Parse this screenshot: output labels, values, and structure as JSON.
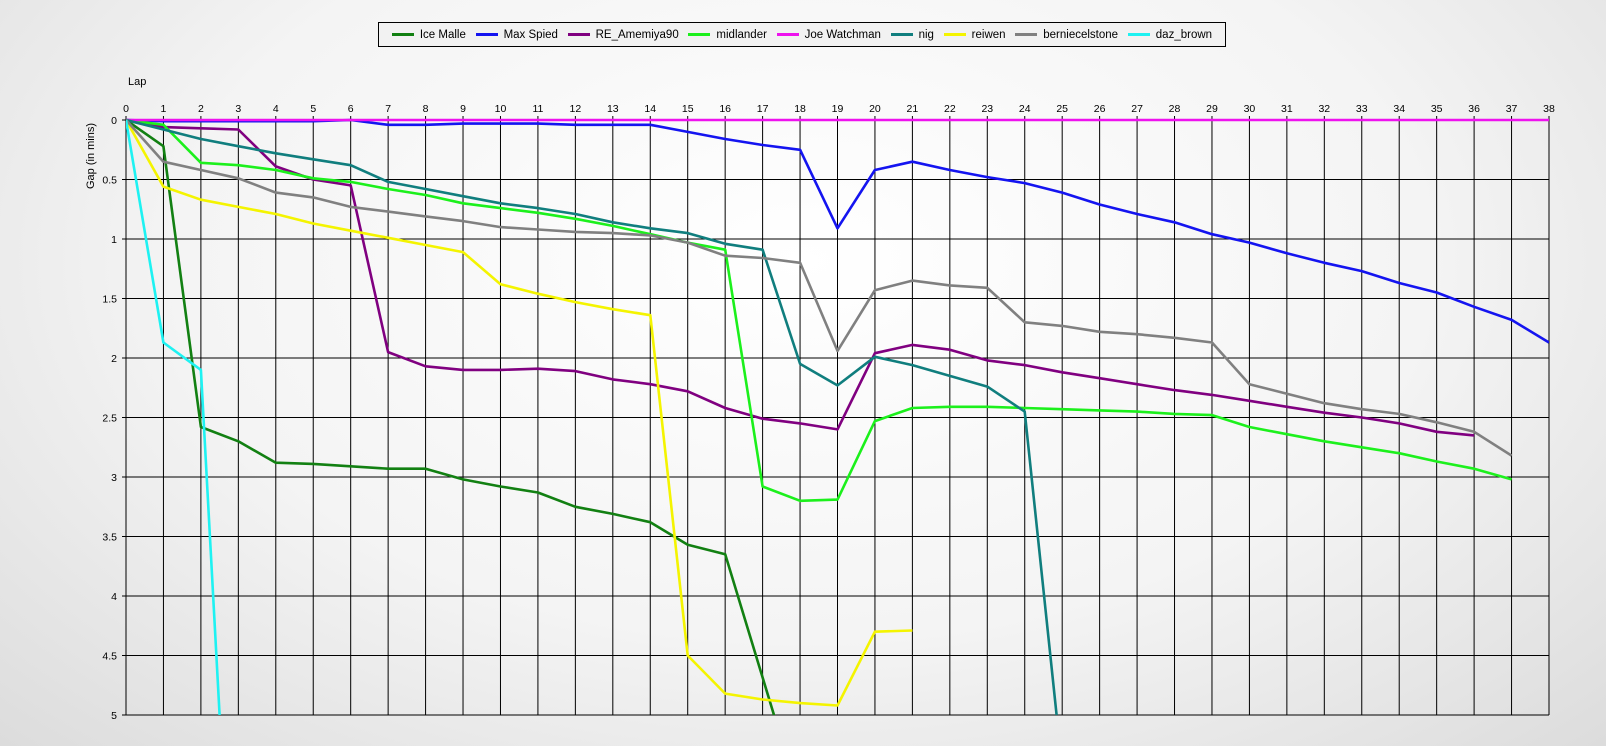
{
  "chart_data": {
    "type": "line",
    "title": "",
    "xlabel": "Lap",
    "ylabel": "Gap (in mins)",
    "xlim": [
      0,
      38
    ],
    "ylim": [
      0,
      5
    ],
    "y_inverted": true,
    "grid": true,
    "legend_position": "top-center",
    "x_ticks": [
      0,
      1,
      2,
      3,
      4,
      5,
      6,
      7,
      8,
      9,
      10,
      11,
      12,
      13,
      14,
      15,
      16,
      17,
      18,
      19,
      20,
      21,
      22,
      23,
      24,
      25,
      26,
      27,
      28,
      29,
      30,
      31,
      32,
      33,
      34,
      35,
      36,
      37,
      38
    ],
    "y_ticks": [
      0,
      0.5,
      1,
      1.5,
      2,
      2.5,
      3,
      3.5,
      4,
      4.5,
      5
    ],
    "y_tick_labels": [
      "0",
      "0.5",
      "1",
      "1.5",
      "2",
      "2.5",
      "3",
      "3.5",
      "4",
      "4.5",
      "5"
    ],
    "series": [
      {
        "name": "Ice Malle",
        "color": "#128012",
        "x": [
          0,
          1,
          2,
          3,
          4,
          5,
          6,
          7,
          8,
          9,
          10,
          11,
          12,
          13,
          14,
          15,
          16,
          17.4
        ],
        "y": [
          0,
          0.22,
          2.58,
          2.7,
          2.88,
          2.89,
          2.91,
          2.93,
          2.93,
          3.02,
          3.08,
          3.13,
          3.25,
          3.31,
          3.38,
          3.57,
          3.65,
          5.1
        ]
      },
      {
        "name": "Max Spied",
        "color": "#1414f0",
        "x": [
          0,
          1,
          2,
          3,
          4,
          5,
          6,
          7,
          8,
          9,
          10,
          11,
          12,
          13,
          14,
          15,
          16,
          17,
          18,
          19,
          20,
          21,
          22,
          23,
          24,
          25,
          26,
          27,
          28,
          29,
          30,
          31,
          32,
          33,
          34,
          35,
          36,
          37,
          38
        ],
        "y": [
          0,
          0.01,
          0.01,
          0.01,
          0.01,
          0.01,
          0,
          0.04,
          0.04,
          0.03,
          0.03,
          0.03,
          0.04,
          0.04,
          0.04,
          0.1,
          0.16,
          0.21,
          0.25,
          0.91,
          0.42,
          0.35,
          0.42,
          0.48,
          0.53,
          0.61,
          0.71,
          0.79,
          0.86,
          0.96,
          1.03,
          1.12,
          1.2,
          1.27,
          1.37,
          1.45,
          1.57,
          1.68,
          1.87
        ]
      },
      {
        "name": "RE_Amemiya90",
        "color": "#800080",
        "x": [
          0,
          1,
          2,
          3,
          4,
          5,
          6,
          7,
          8,
          9,
          10,
          11,
          12,
          13,
          14,
          15,
          16,
          17,
          18,
          19,
          20,
          21,
          22,
          23,
          24,
          25,
          26,
          27,
          28,
          29,
          30,
          31,
          32,
          33,
          34,
          35,
          36
        ],
        "y": [
          0,
          0.06,
          0.07,
          0.08,
          0.39,
          0.5,
          0.55,
          1.95,
          2.07,
          2.1,
          2.1,
          2.09,
          2.11,
          2.18,
          2.22,
          2.28,
          2.42,
          2.51,
          2.55,
          2.6,
          1.96,
          1.89,
          1.93,
          2.02,
          2.06,
          2.12,
          2.17,
          2.22,
          2.27,
          2.31,
          2.36,
          2.41,
          2.46,
          2.5,
          2.55,
          2.62,
          2.65
        ]
      },
      {
        "name": "midlander",
        "color": "#1cf01c",
        "x": [
          0,
          1,
          2,
          3,
          4,
          5,
          6,
          7,
          8,
          9,
          10,
          11,
          12,
          13,
          14,
          15,
          16,
          17,
          18,
          19,
          20,
          21,
          22,
          23,
          24,
          25,
          26,
          27,
          28,
          29,
          30,
          31,
          32,
          33,
          34,
          35,
          36,
          37
        ],
        "y": [
          0,
          0.04,
          0.36,
          0.38,
          0.42,
          0.49,
          0.52,
          0.58,
          0.63,
          0.7,
          0.74,
          0.78,
          0.83,
          0.89,
          0.96,
          1.03,
          1.09,
          3.08,
          3.2,
          3.19,
          2.53,
          2.42,
          2.41,
          2.41,
          2.42,
          2.43,
          2.44,
          2.45,
          2.47,
          2.48,
          2.58,
          2.64,
          2.7,
          2.75,
          2.8,
          2.87,
          2.93,
          3.02
        ]
      },
      {
        "name": "Joe Watchman",
        "color": "#ee12ee",
        "x": [
          0,
          38
        ],
        "y": [
          0,
          0
        ]
      },
      {
        "name": "nig",
        "color": "#107e7e",
        "x": [
          0,
          1,
          2,
          3,
          4,
          5,
          6,
          7,
          8,
          9,
          10,
          11,
          12,
          13,
          14,
          15,
          16,
          17,
          18,
          19,
          20,
          21,
          22,
          23,
          24,
          24.85
        ],
        "y": [
          0,
          0.08,
          0.16,
          0.22,
          0.28,
          0.33,
          0.38,
          0.52,
          0.58,
          0.64,
          0.7,
          0.74,
          0.79,
          0.86,
          0.91,
          0.95,
          1.04,
          1.09,
          2.05,
          2.23,
          1.99,
          2.06,
          2.15,
          2.24,
          2.45,
          5.0
        ]
      },
      {
        "name": "reiwen",
        "color": "#f4f400",
        "x": [
          0,
          1,
          2,
          3,
          4,
          5,
          6,
          7,
          8,
          9,
          10,
          11,
          12,
          13,
          14,
          15,
          16,
          17,
          18,
          19,
          20,
          21
        ],
        "y": [
          0,
          0.56,
          0.67,
          0.73,
          0.79,
          0.87,
          0.93,
          0.99,
          1.05,
          1.11,
          1.38,
          1.46,
          1.53,
          1.59,
          1.64,
          4.5,
          4.82,
          4.87,
          4.9,
          4.92,
          4.3,
          4.29
        ]
      },
      {
        "name": "berniecelstone",
        "color": "#808080",
        "x": [
          0,
          1,
          2,
          3,
          4,
          5,
          6,
          7,
          8,
          9,
          10,
          11,
          12,
          13,
          14,
          15,
          16,
          17,
          18,
          19,
          20,
          21,
          22,
          23,
          24,
          25,
          26,
          27,
          28,
          29,
          30,
          31,
          32,
          33,
          34,
          35,
          36,
          37
        ],
        "y": [
          0,
          0.35,
          0.42,
          0.49,
          0.61,
          0.65,
          0.73,
          0.77,
          0.81,
          0.85,
          0.9,
          0.92,
          0.94,
          0.95,
          0.97,
          1.03,
          1.14,
          1.16,
          1.2,
          1.94,
          1.43,
          1.35,
          1.39,
          1.41,
          1.7,
          1.73,
          1.78,
          1.8,
          1.83,
          1.87,
          2.22,
          2.3,
          2.38,
          2.43,
          2.47,
          2.54,
          2.62,
          2.82
        ]
      },
      {
        "name": "daz_brown",
        "color": "#1ef2f2",
        "x": [
          0,
          1,
          2,
          2.5
        ],
        "y": [
          0,
          1.87,
          2.1,
          5.0
        ]
      }
    ]
  }
}
